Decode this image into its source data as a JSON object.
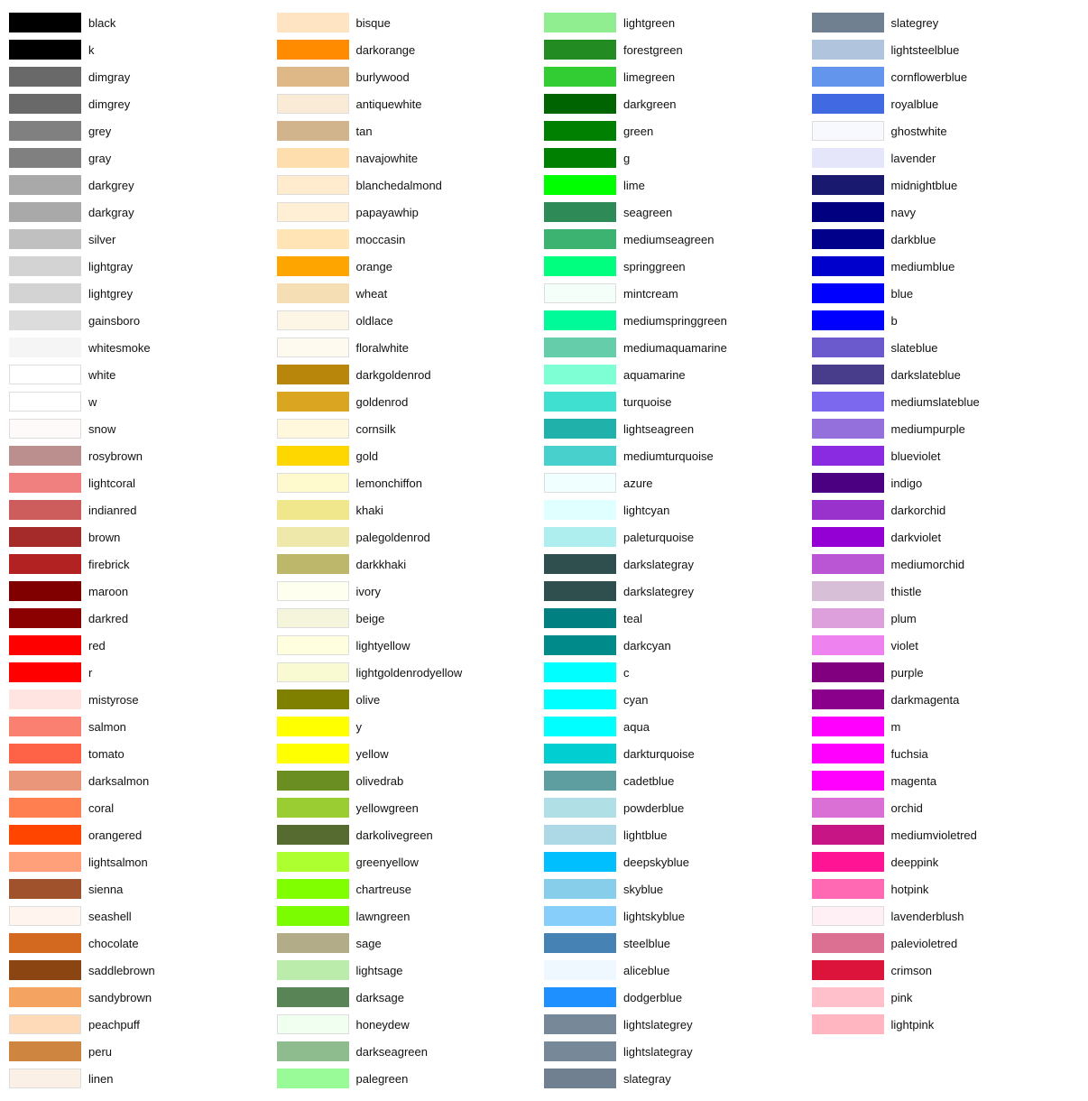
{
  "columns": [
    {
      "id": "col1",
      "items": [
        {
          "name": "black",
          "color": "#000000"
        },
        {
          "name": "k",
          "color": "#000000"
        },
        {
          "name": "dimgray",
          "color": "#696969"
        },
        {
          "name": "dimgrey",
          "color": "#696969"
        },
        {
          "name": "grey",
          "color": "#808080"
        },
        {
          "name": "gray",
          "color": "#808080"
        },
        {
          "name": "darkgrey",
          "color": "#A9A9A9"
        },
        {
          "name": "darkgray",
          "color": "#A9A9A9"
        },
        {
          "name": "silver",
          "color": "#C0C0C0"
        },
        {
          "name": "lightgray",
          "color": "#D3D3D3"
        },
        {
          "name": "lightgrey",
          "color": "#D3D3D3"
        },
        {
          "name": "gainsboro",
          "color": "#DCDCDC"
        },
        {
          "name": "whitesmoke",
          "color": "#F5F5F5"
        },
        {
          "name": "white",
          "color": "#FFFFFF"
        },
        {
          "name": "w",
          "color": "#FFFFFF"
        },
        {
          "name": "snow",
          "color": "#FFFAFA"
        },
        {
          "name": "rosybrown",
          "color": "#BC8F8F"
        },
        {
          "name": "lightcoral",
          "color": "#F08080"
        },
        {
          "name": "indianred",
          "color": "#CD5C5C"
        },
        {
          "name": "brown",
          "color": "#A52A2A"
        },
        {
          "name": "firebrick",
          "color": "#B22222"
        },
        {
          "name": "maroon",
          "color": "#800000"
        },
        {
          "name": "darkred",
          "color": "#8B0000"
        },
        {
          "name": "red",
          "color": "#FF0000"
        },
        {
          "name": "r",
          "color": "#FF0000"
        },
        {
          "name": "mistyrose",
          "color": "#FFE4E1"
        },
        {
          "name": "salmon",
          "color": "#FA8072"
        },
        {
          "name": "tomato",
          "color": "#FF6347"
        },
        {
          "name": "darksalmon",
          "color": "#E9967A"
        },
        {
          "name": "coral",
          "color": "#FF7F50"
        },
        {
          "name": "orangered",
          "color": "#FF4500"
        },
        {
          "name": "lightsalmon",
          "color": "#FFA07A"
        },
        {
          "name": "sienna",
          "color": "#A0522D"
        },
        {
          "name": "seashell",
          "color": "#FFF5EE"
        },
        {
          "name": "chocolate",
          "color": "#D2691E"
        },
        {
          "name": "saddlebrown",
          "color": "#8B4513"
        },
        {
          "name": "sandybrown",
          "color": "#F4A460"
        },
        {
          "name": "peachpuff",
          "color": "#FFDAB9"
        },
        {
          "name": "peru",
          "color": "#CD853F"
        },
        {
          "name": "linen",
          "color": "#FAF0E6"
        }
      ]
    },
    {
      "id": "col2",
      "items": [
        {
          "name": "bisque",
          "color": "#FFE4C4"
        },
        {
          "name": "darkorange",
          "color": "#FF8C00"
        },
        {
          "name": "burlywood",
          "color": "#DEB887"
        },
        {
          "name": "antiquewhite",
          "color": "#FAEBD7"
        },
        {
          "name": "tan",
          "color": "#D2B48C"
        },
        {
          "name": "navajowhite",
          "color": "#FFDEAD"
        },
        {
          "name": "blanchedalmond",
          "color": "#FFEBCD"
        },
        {
          "name": "papayawhip",
          "color": "#FFEFD5"
        },
        {
          "name": "moccasin",
          "color": "#FFE4B5"
        },
        {
          "name": "orange",
          "color": "#FFA500"
        },
        {
          "name": "wheat",
          "color": "#F5DEB3"
        },
        {
          "name": "oldlace",
          "color": "#FDF5E6"
        },
        {
          "name": "floralwhite",
          "color": "#FFFAF0"
        },
        {
          "name": "darkgoldenrod",
          "color": "#B8860B"
        },
        {
          "name": "goldenrod",
          "color": "#DAA520"
        },
        {
          "name": "cornsilk",
          "color": "#FFF8DC"
        },
        {
          "name": "gold",
          "color": "#FFD700"
        },
        {
          "name": "lemonchiffon",
          "color": "#FFFACD"
        },
        {
          "name": "khaki",
          "color": "#F0E68C"
        },
        {
          "name": "palegoldenrod",
          "color": "#EEE8AA"
        },
        {
          "name": "darkkhaki",
          "color": "#BDB76B"
        },
        {
          "name": "ivory",
          "color": "#FFFFF0"
        },
        {
          "name": "beige",
          "color": "#F5F5DC"
        },
        {
          "name": "lightyellow",
          "color": "#FFFFE0"
        },
        {
          "name": "lightgoldenrodyellow",
          "color": "#FAFAD2"
        },
        {
          "name": "olive",
          "color": "#808000"
        },
        {
          "name": "y",
          "color": "#FFFF00"
        },
        {
          "name": "yellow",
          "color": "#FFFF00"
        },
        {
          "name": "olivedrab",
          "color": "#6B8E23"
        },
        {
          "name": "yellowgreen",
          "color": "#9ACD32"
        },
        {
          "name": "darkolivegreen",
          "color": "#556B2F"
        },
        {
          "name": "greenyellow",
          "color": "#ADFF2F"
        },
        {
          "name": "chartreuse",
          "color": "#7FFF00"
        },
        {
          "name": "lawngreen",
          "color": "#7CFC00"
        },
        {
          "name": "sage",
          "color": "#B2AC88"
        },
        {
          "name": "lightsage",
          "color": "#BCECAC"
        },
        {
          "name": "darksage",
          "color": "#598556"
        },
        {
          "name": "honeydew",
          "color": "#F0FFF0"
        },
        {
          "name": "darkseagreen",
          "color": "#8FBC8F"
        },
        {
          "name": "palegreen",
          "color": "#98FB98"
        }
      ]
    },
    {
      "id": "col3",
      "items": [
        {
          "name": "lightgreen",
          "color": "#90EE90"
        },
        {
          "name": "forestgreen",
          "color": "#228B22"
        },
        {
          "name": "limegreen",
          "color": "#32CD32"
        },
        {
          "name": "darkgreen",
          "color": "#006400"
        },
        {
          "name": "green",
          "color": "#008000"
        },
        {
          "name": "g",
          "color": "#008000"
        },
        {
          "name": "lime",
          "color": "#00FF00"
        },
        {
          "name": "seagreen",
          "color": "#2E8B57"
        },
        {
          "name": "mediumseagreen",
          "color": "#3CB371"
        },
        {
          "name": "springgreen",
          "color": "#00FF7F"
        },
        {
          "name": "mintcream",
          "color": "#F5FFFA"
        },
        {
          "name": "mediumspringgreen",
          "color": "#00FA9A"
        },
        {
          "name": "mediumaquamarine",
          "color": "#66CDAA"
        },
        {
          "name": "aquamarine",
          "color": "#7FFFD4"
        },
        {
          "name": "turquoise",
          "color": "#40E0D0"
        },
        {
          "name": "lightseagreen",
          "color": "#20B2AA"
        },
        {
          "name": "mediumturquoise",
          "color": "#48D1CC"
        },
        {
          "name": "azure",
          "color": "#F0FFFF"
        },
        {
          "name": "lightcyan",
          "color": "#E0FFFF"
        },
        {
          "name": "paleturquoise",
          "color": "#AFEEEE"
        },
        {
          "name": "darkslategray",
          "color": "#2F4F4F"
        },
        {
          "name": "darkslategrey",
          "color": "#2F4F4F"
        },
        {
          "name": "teal",
          "color": "#008080"
        },
        {
          "name": "darkcyan",
          "color": "#008B8B"
        },
        {
          "name": "c",
          "color": "#00FFFF"
        },
        {
          "name": "cyan",
          "color": "#00FFFF"
        },
        {
          "name": "aqua",
          "color": "#00FFFF"
        },
        {
          "name": "darkturquoise",
          "color": "#00CED1"
        },
        {
          "name": "cadetblue",
          "color": "#5F9EA0"
        },
        {
          "name": "powderblue",
          "color": "#B0E0E6"
        },
        {
          "name": "lightblue",
          "color": "#ADD8E6"
        },
        {
          "name": "deepskyblue",
          "color": "#00BFFF"
        },
        {
          "name": "skyblue",
          "color": "#87CEEB"
        },
        {
          "name": "lightskyblue",
          "color": "#87CEFA"
        },
        {
          "name": "steelblue",
          "color": "#4682B4"
        },
        {
          "name": "aliceblue",
          "color": "#F0F8FF"
        },
        {
          "name": "dodgerblue",
          "color": "#1E90FF"
        },
        {
          "name": "lightslategrey",
          "color": "#778899"
        },
        {
          "name": "lightslategray",
          "color": "#778899"
        },
        {
          "name": "slategray",
          "color": "#708090"
        }
      ]
    },
    {
      "id": "col4",
      "items": [
        {
          "name": "slategrey",
          "color": "#708090"
        },
        {
          "name": "lightsteelblue",
          "color": "#B0C4DE"
        },
        {
          "name": "cornflowerblue",
          "color": "#6495ED"
        },
        {
          "name": "royalblue",
          "color": "#4169E1"
        },
        {
          "name": "ghostwhite",
          "color": "#F8F8FF"
        },
        {
          "name": "lavender",
          "color": "#E6E6FA"
        },
        {
          "name": "midnightblue",
          "color": "#191970"
        },
        {
          "name": "navy",
          "color": "#000080"
        },
        {
          "name": "darkblue",
          "color": "#00008B"
        },
        {
          "name": "mediumblue",
          "color": "#0000CD"
        },
        {
          "name": "blue",
          "color": "#0000FF"
        },
        {
          "name": "b",
          "color": "#0000FF"
        },
        {
          "name": "slateblue",
          "color": "#6A5ACD"
        },
        {
          "name": "darkslateblue",
          "color": "#483D8B"
        },
        {
          "name": "mediumslateblue",
          "color": "#7B68EE"
        },
        {
          "name": "mediumpurple",
          "color": "#9370DB"
        },
        {
          "name": "blueviolet",
          "color": "#8A2BE2"
        },
        {
          "name": "indigo",
          "color": "#4B0082"
        },
        {
          "name": "darkorchid",
          "color": "#9932CC"
        },
        {
          "name": "darkviolet",
          "color": "#9400D3"
        },
        {
          "name": "mediumorchid",
          "color": "#BA55D3"
        },
        {
          "name": "thistle",
          "color": "#D8BFD8"
        },
        {
          "name": "plum",
          "color": "#DDA0DD"
        },
        {
          "name": "violet",
          "color": "#EE82EE"
        },
        {
          "name": "purple",
          "color": "#800080"
        },
        {
          "name": "darkmagenta",
          "color": "#8B008B"
        },
        {
          "name": "m",
          "color": "#FF00FF"
        },
        {
          "name": "fuchsia",
          "color": "#FF00FF"
        },
        {
          "name": "magenta",
          "color": "#FF00FF"
        },
        {
          "name": "orchid",
          "color": "#DA70D6"
        },
        {
          "name": "mediumvioletred",
          "color": "#C71585"
        },
        {
          "name": "deeppink",
          "color": "#FF1493"
        },
        {
          "name": "hotpink",
          "color": "#FF69B4"
        },
        {
          "name": "lavenderblush",
          "color": "#FFF0F5"
        },
        {
          "name": "palevioletred",
          "color": "#DB7093"
        },
        {
          "name": "crimson",
          "color": "#DC143C"
        },
        {
          "name": "pink",
          "color": "#FFC0CB"
        },
        {
          "name": "lightpink",
          "color": "#FFB6C1"
        },
        {
          "name": "_empty1",
          "color": ""
        },
        {
          "name": "_empty2",
          "color": ""
        }
      ]
    }
  ]
}
